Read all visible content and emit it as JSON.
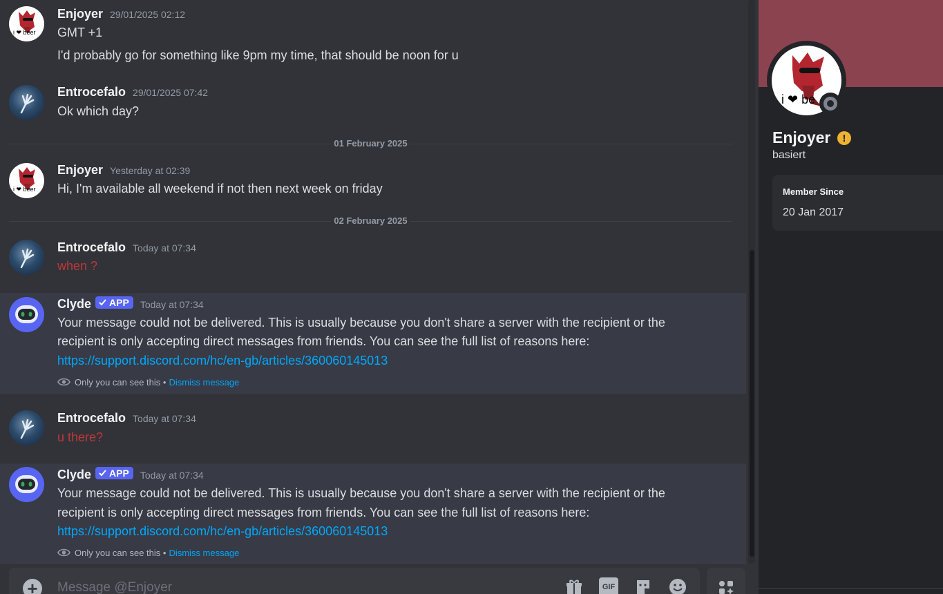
{
  "messages": [
    {
      "author": "Enjoyer",
      "timestamp": "29/01/2025 02:12",
      "lines": [
        "GMT +1",
        "I'd probably go for something like 9pm my time, that should be  noon for u"
      ]
    },
    {
      "author": "Entrocefalo",
      "timestamp": "29/01/2025 07:42",
      "lines": [
        "Ok which day?"
      ]
    },
    {
      "author": "Enjoyer",
      "timestamp": "Yesterday at 02:39",
      "lines": [
        "Hi, I'm available all weekend if not then next week on friday"
      ]
    },
    {
      "author": "Entrocefalo",
      "timestamp": "Today at 07:34",
      "lines": [
        "when ?"
      ],
      "failed": true
    },
    {
      "author": "Clyde",
      "tag": "APP",
      "timestamp": "Today at 07:34",
      "lines": [
        "Your message could not be delivered. This is usually because you don't share a server with the recipient or the",
        "recipient is only accepting direct messages from friends. You can see the full list of reasons here:"
      ],
      "link": "https://support.discord.com/hc/en-gb/articles/360060145013",
      "note": "Only you can see this •",
      "dismiss": "Dismiss message"
    },
    {
      "author": "Entrocefalo",
      "timestamp": "Today at 07:34",
      "lines": [
        "u there?"
      ],
      "failed": true
    },
    {
      "author": "Clyde",
      "tag": "APP",
      "timestamp": "Today at 07:34",
      "lines": [
        "Your message could not be delivered. This is usually because you don't share a server with the recipient or the",
        "recipient is only accepting direct messages from friends. You can see the full list of reasons here:"
      ],
      "link": "https://support.discord.com/hc/en-gb/articles/360060145013",
      "note": "Only you can see this •",
      "dismiss": "Dismiss message"
    }
  ],
  "dividers": [
    "01 February 2025",
    "02 February 2025"
  ],
  "composer": {
    "placeholder": "Message @Enjoyer",
    "gif_label": "GIF"
  },
  "avatar_caption": {
    "enjoyer": "i ❤ beer",
    "profile": "i ❤ be"
  },
  "profile": {
    "name": "Enjoyer",
    "username": "basiert",
    "warning_glyph": "!",
    "member_since_label": "Member Since",
    "member_since_value": "20 Jan 2017",
    "banner_color": "#8c4350",
    "status": "offline"
  },
  "icons": [
    "add-attachment-icon",
    "gift-icon",
    "gif-icon",
    "sticker-icon",
    "emoji-icon",
    "apps-icon",
    "eye-icon",
    "verified-check-icon",
    "warning-icon"
  ],
  "colors": {
    "accent": "#5865f2",
    "link": "#00a8fc",
    "failed": "#da373c",
    "background": "#313338"
  }
}
